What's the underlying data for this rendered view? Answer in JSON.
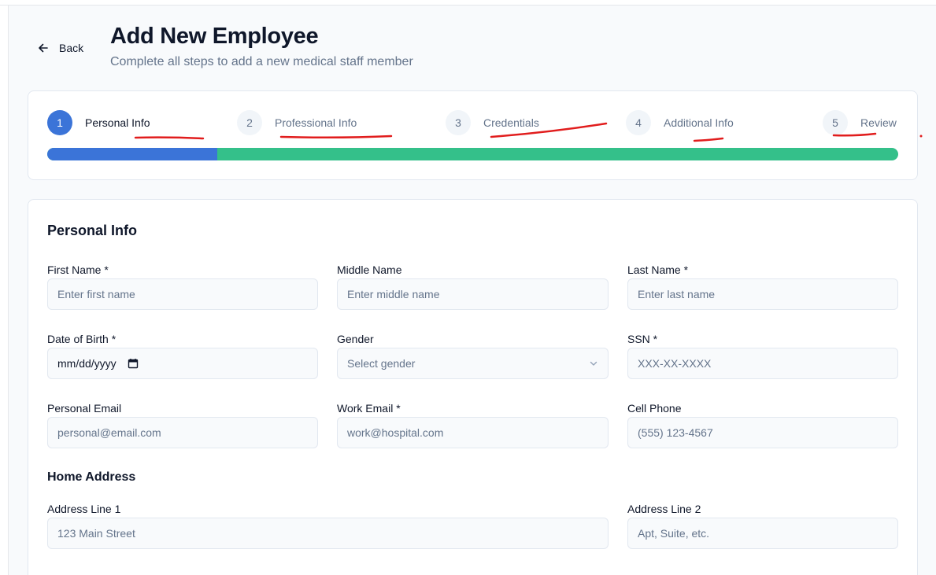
{
  "header": {
    "back_label": "Back",
    "title": "Add New Employee",
    "subtitle": "Complete all steps to add a new medical staff member"
  },
  "stepper": {
    "steps": [
      {
        "number": "1",
        "label": "Personal Info",
        "active": true
      },
      {
        "number": "2",
        "label": "Professional Info",
        "active": false
      },
      {
        "number": "3",
        "label": "Credentials",
        "active": false
      },
      {
        "number": "4",
        "label": "Additional Info",
        "active": false
      },
      {
        "number": "5",
        "label": "Review",
        "active": false
      }
    ],
    "progress_fraction": 0.2,
    "colors": {
      "active": "#3b74d8",
      "remaining": "#34c08a"
    }
  },
  "annotation_color": "#e11d1d",
  "form": {
    "section_title": "Personal Info",
    "fields": {
      "first_name": {
        "label": "First Name *",
        "placeholder": "Enter first name"
      },
      "middle_name": {
        "label": "Middle Name",
        "placeholder": "Enter middle name"
      },
      "last_name": {
        "label": "Last Name *",
        "placeholder": "Enter last name"
      },
      "dob": {
        "label": "Date of Birth *",
        "value": "mm/dd/yyyy"
      },
      "gender": {
        "label": "Gender",
        "value": "Select gender"
      },
      "ssn": {
        "label": "SSN *",
        "placeholder": "XXX-XX-XXXX"
      },
      "personal_email": {
        "label": "Personal Email",
        "placeholder": "personal@email.com"
      },
      "work_email": {
        "label": "Work Email *",
        "placeholder": "work@hospital.com"
      },
      "cell_phone": {
        "label": "Cell Phone",
        "placeholder": "(555) 123-4567"
      }
    },
    "address": {
      "title": "Home Address",
      "line1": {
        "label": "Address Line 1",
        "placeholder": "123 Main Street"
      },
      "line2": {
        "label": "Address Line 2",
        "placeholder": "Apt, Suite, etc."
      }
    }
  }
}
